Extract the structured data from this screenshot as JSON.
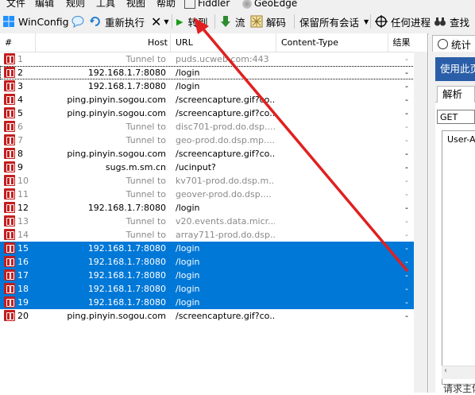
{
  "menu": [
    "文件",
    "编辑",
    "规则",
    "工具",
    "视图",
    "帮助",
    "Fiddler",
    "GeoEdge"
  ],
  "toolbar": {
    "winconfig": "WinConfig",
    "replay": "重新执行",
    "go": "转到",
    "stream": "流",
    "decode": "解码",
    "keep_sessions": "保留所有会话",
    "any_process": "任何进程",
    "find": "查找"
  },
  "columns": {
    "num": "#",
    "host": "Host",
    "url": "URL",
    "content_type": "Content-Type",
    "result": "结果"
  },
  "sessions": [
    {
      "num": "1",
      "host": "Tunnel to",
      "url": "puds.ucweb.com:443",
      "result": "-",
      "style": "dim"
    },
    {
      "num": "2",
      "host": "192.168.1.7:8080",
      "url": "/login",
      "result": "-",
      "style": "focus"
    },
    {
      "num": "3",
      "host": "192.168.1.7:8080",
      "url": "/login",
      "result": "-",
      "style": ""
    },
    {
      "num": "4",
      "host": "ping.pinyin.sogou.com",
      "url": "/screencapture.gif?co...",
      "result": "-",
      "style": ""
    },
    {
      "num": "5",
      "host": "ping.pinyin.sogou.com",
      "url": "/screencapture.gif?co...",
      "result": "-",
      "style": ""
    },
    {
      "num": "6",
      "host": "Tunnel to",
      "url": "disc701-prod.do.dsp....",
      "result": "-",
      "style": "dim"
    },
    {
      "num": "7",
      "host": "Tunnel to",
      "url": "geo-prod.do.dsp.mp....",
      "result": "-",
      "style": "dim"
    },
    {
      "num": "8",
      "host": "ping.pinyin.sogou.com",
      "url": "/screencapture.gif?co...",
      "result": "-",
      "style": ""
    },
    {
      "num": "9",
      "host": "sugs.m.sm.cn",
      "url": "/ucinput?",
      "result": "-",
      "style": ""
    },
    {
      "num": "10",
      "host": "Tunnel to",
      "url": "kv701-prod.do.dsp.m...",
      "result": "-",
      "style": "dim"
    },
    {
      "num": "11",
      "host": "Tunnel to",
      "url": "geover-prod.do.dsp....",
      "result": "-",
      "style": "dim"
    },
    {
      "num": "12",
      "host": "192.168.1.7:8080",
      "url": "/login",
      "result": "-",
      "style": ""
    },
    {
      "num": "13",
      "host": "Tunnel to",
      "url": "v20.events.data.micr...",
      "result": "-",
      "style": "dim"
    },
    {
      "num": "14",
      "host": "Tunnel to",
      "url": "array711-prod.do.dsp...",
      "result": "-",
      "style": "dim"
    },
    {
      "num": "15",
      "host": "192.168.1.7:8080",
      "url": "/login",
      "result": "-",
      "style": "sel"
    },
    {
      "num": "16",
      "host": "192.168.1.7:8080",
      "url": "/login",
      "result": "-",
      "style": "sel"
    },
    {
      "num": "17",
      "host": "192.168.1.7:8080",
      "url": "/login",
      "result": "-",
      "style": "sel"
    },
    {
      "num": "18",
      "host": "192.168.1.7:8080",
      "url": "/login",
      "result": "-",
      "style": "sel"
    },
    {
      "num": "19",
      "host": "192.168.1.7:8080",
      "url": "/login",
      "result": "-",
      "style": "sel"
    },
    {
      "num": "20",
      "host": "ping.pinyin.sogou.com",
      "url": "/screencapture.gif?co...",
      "result": "-",
      "style": ""
    }
  ],
  "right_panel": {
    "stats_tab": "统计",
    "info_bar": "使用此页",
    "parse_tab": "解析",
    "method": "GET",
    "header_text": "User-Ag",
    "footer_text": "请求主体"
  },
  "colors": {
    "selection": "#0078d7",
    "annotation_arrow": "#e02020",
    "session_icon": "#c41e1e"
  }
}
